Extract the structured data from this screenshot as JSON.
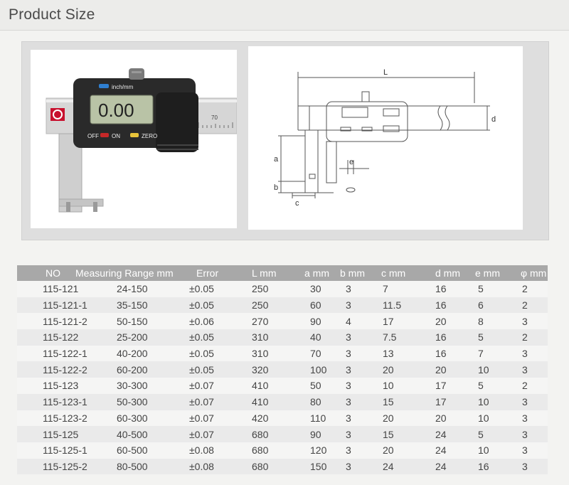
{
  "header": {
    "title": "Product Size"
  },
  "photo": {
    "display_mode": "inch/mm",
    "readout": "0.00",
    "off_label": "OFF",
    "on_label": "ON",
    "zero_label": "ZERO",
    "scale_mark": "70"
  },
  "drawing": {
    "labels": {
      "L": "L",
      "d": "d",
      "a": "a",
      "b": "b",
      "c": "c",
      "e": "e"
    }
  },
  "table": {
    "columns": [
      "NO",
      "Measuring Range mm",
      "Error",
      "L mm",
      "a mm",
      "b mm",
      "c mm",
      "d mm",
      "e mm",
      "φ mm"
    ],
    "rows": [
      [
        "115-121",
        "24-150",
        "±0.05",
        "250",
        "30",
        "3",
        "7",
        "16",
        "5",
        "2"
      ],
      [
        "115-121-1",
        "35-150",
        "±0.05",
        "250",
        "60",
        "3",
        "11.5",
        "16",
        "6",
        "2"
      ],
      [
        "115-121-2",
        "50-150",
        "±0.06",
        "270",
        "90",
        "4",
        "17",
        "20",
        "8",
        "3"
      ],
      [
        "115-122",
        "25-200",
        "±0.05",
        "310",
        "40",
        "3",
        "7.5",
        "16",
        "5",
        "2"
      ],
      [
        "115-122-1",
        "40-200",
        "±0.05",
        "310",
        "70",
        "3",
        "13",
        "16",
        "7",
        "3"
      ],
      [
        "115-122-2",
        "60-200",
        "±0.05",
        "320",
        "100",
        "3",
        "20",
        "20",
        "10",
        "3"
      ],
      [
        "115-123",
        "30-300",
        "±0.07",
        "410",
        "50",
        "3",
        "10",
        "17",
        "5",
        "2"
      ],
      [
        "115-123-1",
        "50-300",
        "±0.07",
        "410",
        "80",
        "3",
        "15",
        "17",
        "10",
        "3"
      ],
      [
        "115-123-2",
        "60-300",
        "±0.07",
        "420",
        "110",
        "3",
        "20",
        "20",
        "10",
        "3"
      ],
      [
        "115-125",
        "40-500",
        "±0.07",
        "680",
        "90",
        "3",
        "15",
        "24",
        "5",
        "3"
      ],
      [
        "115-125-1",
        "60-500",
        "±0.08",
        "680",
        "120",
        "3",
        "20",
        "24",
        "10",
        "3"
      ],
      [
        "115-125-2",
        "80-500",
        "±0.08",
        "680",
        "150",
        "3",
        "24",
        "24",
        "16",
        "3"
      ]
    ]
  },
  "colors": {
    "header_bg": "#ececea",
    "table_header_bg": "#a8a8a8",
    "caliper_body": "#2a2a2a",
    "lcd": "#b9c3a6",
    "off_button": "#c62828",
    "zero_button": "#e8c43a",
    "mode_button": "#2f7fd0",
    "logo_red": "#c8102e"
  }
}
